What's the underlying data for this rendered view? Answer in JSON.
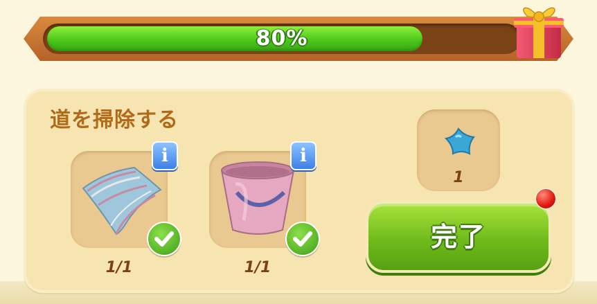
{
  "progress": {
    "label": "80%",
    "percent": 80
  },
  "task": {
    "title": "道を掃除する",
    "items": [
      {
        "name": "cloth",
        "count": "1/1",
        "completed": true,
        "info_label": "i"
      },
      {
        "name": "bucket",
        "count": "1/1",
        "completed": true,
        "info_label": "i"
      }
    ]
  },
  "reward": {
    "icon": "blue-star-icon",
    "count": "1"
  },
  "complete_button": {
    "label": "完了",
    "has_notification": true
  },
  "colors": {
    "progress_fill": "#47c41a",
    "frame": "#c8742f",
    "panel": "#f6e5b0",
    "button": "#6fbb1a",
    "title": "#b06a1a",
    "notification": "#e0170e"
  }
}
